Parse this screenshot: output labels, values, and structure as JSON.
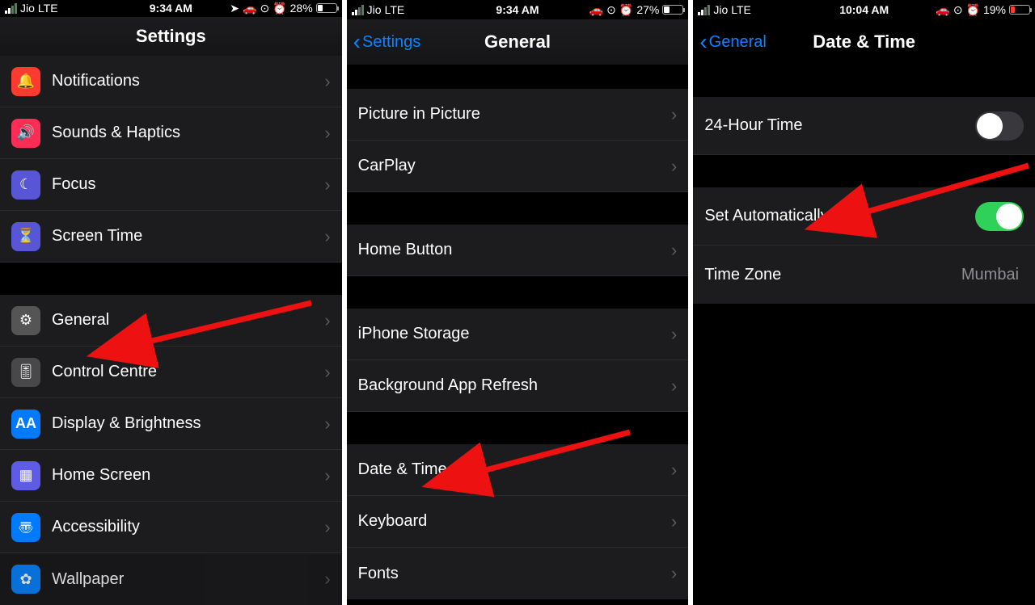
{
  "screens": {
    "settings": {
      "status": {
        "carrier": "Jio",
        "net": "LTE",
        "time": "9:34 AM",
        "battery_pct": "28%"
      },
      "title": "Settings",
      "items": [
        {
          "label": "Notifications",
          "icon": "bell-icon",
          "color": "bg-red"
        },
        {
          "label": "Sounds & Haptics",
          "icon": "speaker-icon",
          "color": "bg-pink"
        },
        {
          "label": "Focus",
          "icon": "moon-icon",
          "color": "bg-purple"
        },
        {
          "label": "Screen Time",
          "icon": "hourglass-icon",
          "color": "bg-purple"
        },
        {
          "label": "General",
          "icon": "gear-icon",
          "color": "bg-gray"
        },
        {
          "label": "Control Centre",
          "icon": "toggles-icon",
          "color": "bg-darkgray"
        },
        {
          "label": "Display & Brightness",
          "icon": "aa-icon",
          "color": "bg-blue"
        },
        {
          "label": "Home Screen",
          "icon": "grid-icon",
          "color": "bg-indigo"
        },
        {
          "label": "Accessibility",
          "icon": "accessibility-icon",
          "color": "bg-blue"
        },
        {
          "label": "Wallpaper",
          "icon": "flower-icon",
          "color": "bg-cyan"
        }
      ]
    },
    "general": {
      "status": {
        "carrier": "Jio",
        "net": "LTE",
        "time": "9:34 AM",
        "battery_pct": "27%"
      },
      "back_label": "Settings",
      "title": "General",
      "groups": [
        [
          "Picture in Picture",
          "CarPlay"
        ],
        [
          "Home Button"
        ],
        [
          "iPhone Storage",
          "Background App Refresh"
        ],
        [
          "Date & Time",
          "Keyboard",
          "Fonts"
        ]
      ]
    },
    "datetime": {
      "status": {
        "carrier": "Jio",
        "net": "LTE",
        "time": "10:04 AM",
        "battery_pct": "19%"
      },
      "back_label": "General",
      "title": "Date & Time",
      "rows": {
        "twentyfour": {
          "label": "24-Hour Time",
          "on": false
        },
        "auto": {
          "label": "Set Automatically",
          "on": true
        },
        "zone": {
          "label": "Time Zone",
          "value": "Mumbai"
        }
      }
    }
  }
}
